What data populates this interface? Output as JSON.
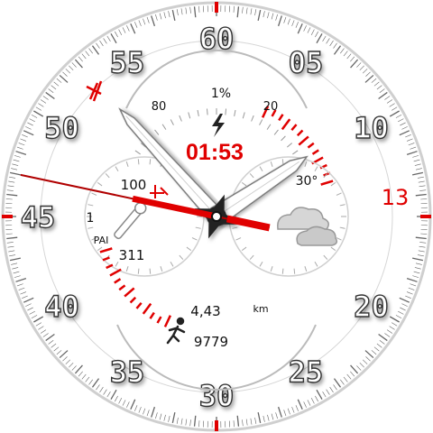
{
  "watch": {
    "digital_time": "01:53",
    "date": "13",
    "minute_markers": [
      "60",
      "05",
      "10",
      "20",
      "25",
      "30",
      "35",
      "40",
      "45",
      "50",
      "55"
    ],
    "battery_percent": "1%",
    "battery_gauge_low": "80",
    "battery_gauge_high": "20",
    "temperature": "30°",
    "heart_rate": "100",
    "pai_value": "1",
    "pai_label": "PAI",
    "calories": "311",
    "distance": "4,43",
    "distance_unit": "km",
    "steps": "9779",
    "hands": {
      "hour": 1,
      "minute": 53,
      "second": 47
    }
  },
  "colors": {
    "accent": "#e00000",
    "hand_fill": "#ffffff",
    "hand_stroke": "#777777",
    "hub": "#222222",
    "ring_stroke": "#b0b0b0"
  }
}
